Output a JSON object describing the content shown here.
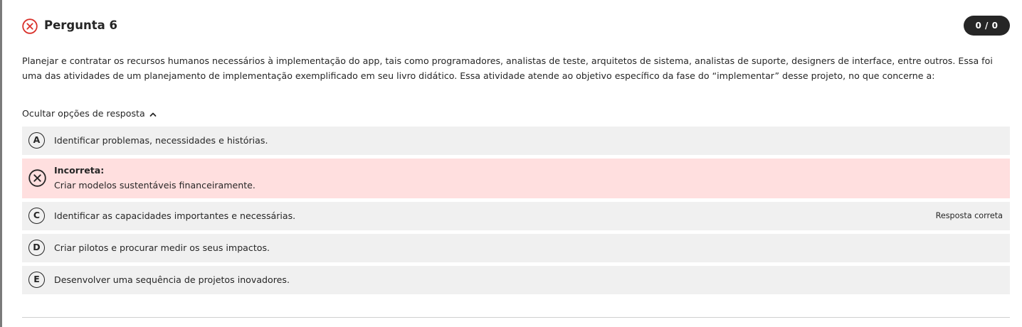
{
  "question": {
    "title": "Pergunta 6",
    "score": "0 / 0",
    "text": "Planejar e contratar os recursos humanos necessários à implementação do app, tais como programadores, analistas de teste, arquitetos de sistema, analistas de suporte, designers de interface, entre outros. Essa foi uma das atividades de um planejamento de implementação exemplificado em seu livro didático. Essa atividade atende ao objetivo específico da fase do “implementar” desse projeto, no que concerne a:",
    "status_icon": "x-circle-icon",
    "status_color": "#d9312b"
  },
  "toggle": {
    "label": "Ocultar opções de resposta",
    "icon": "chevron-up-icon"
  },
  "options": [
    {
      "letter": "A",
      "text": "Identificar problemas, necessidades e histórias."
    },
    {
      "letter": "B",
      "status_label": "Incorreta:",
      "text": "Criar modelos sustentáveis financeiramente.",
      "icon": "x-circle-icon",
      "bg": "#ffdfdf"
    },
    {
      "letter": "C",
      "text": "Identificar as capacidades importantes e necessárias.",
      "tag": "Resposta correta"
    },
    {
      "letter": "D",
      "text": "Criar pilotos e procurar medir os seus impactos."
    },
    {
      "letter": "E",
      "text": "Desenvolver uma sequência de projetos inovadores."
    }
  ]
}
